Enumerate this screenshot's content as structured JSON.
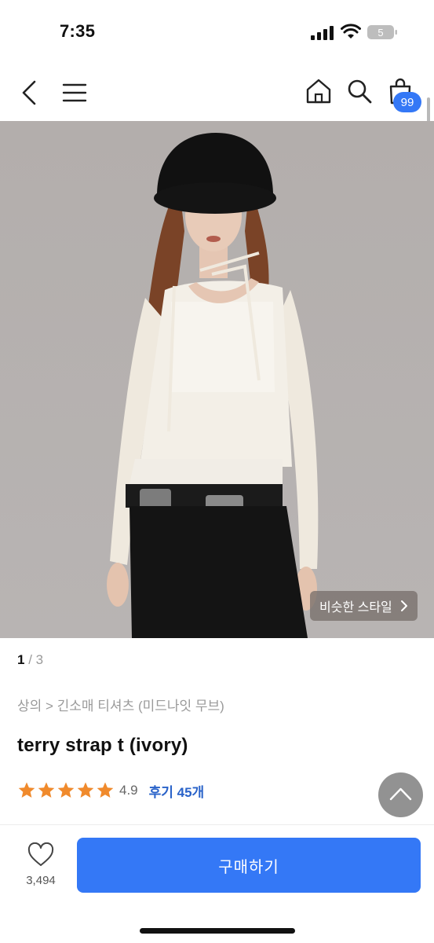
{
  "status_bar": {
    "time": "7:35",
    "battery_level": "5"
  },
  "nav": {
    "cart_count": "99"
  },
  "image_gallery": {
    "current": "1",
    "separator": " / ",
    "total": "3",
    "similar_style_label": "비슷한 스타일"
  },
  "product": {
    "category": "상의 > 긴소매 티셔츠 (미드나잇 무브)",
    "title": "terry strap t (ivory)",
    "rating": "4.9",
    "stars_filled": 5,
    "review_label": "후기 45개"
  },
  "bottom_bar": {
    "like_count": "3,494",
    "buy_label": "구매하기"
  },
  "colors": {
    "accent": "#3478f6",
    "star": "#f08a2c",
    "review_link": "#2a63c9"
  }
}
